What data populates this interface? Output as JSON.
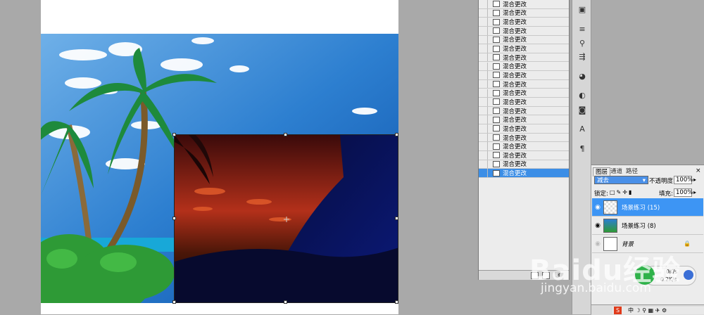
{
  "history": {
    "step_label": "混合更改",
    "row_count": 20,
    "selected_index": 19
  },
  "layers_panel": {
    "tabs": [
      "图层",
      "通道",
      "路径"
    ],
    "blend_mode": "减去",
    "opacity_label": "不透明度:",
    "opacity_value": "100%",
    "lock_label": "锁定:",
    "fill_label": "填充:",
    "fill_value": "100%",
    "layers": [
      {
        "name": "场景练习 (15)",
        "selected": true
      },
      {
        "name": "场景练习 (8)",
        "selected": false
      },
      {
        "name": "背景",
        "selected": false
      }
    ]
  },
  "network_widget": {
    "down": "0K/s",
    "up": "0.2K/s"
  },
  "watermark": {
    "brand": "Baidu经验",
    "url": "jingyan.baidu.com"
  },
  "colors": {
    "selection_blue": "#3d95f4",
    "sky_top": "#1565b8",
    "sunset_red": "#c0331a",
    "night_blue": "#08104a"
  }
}
